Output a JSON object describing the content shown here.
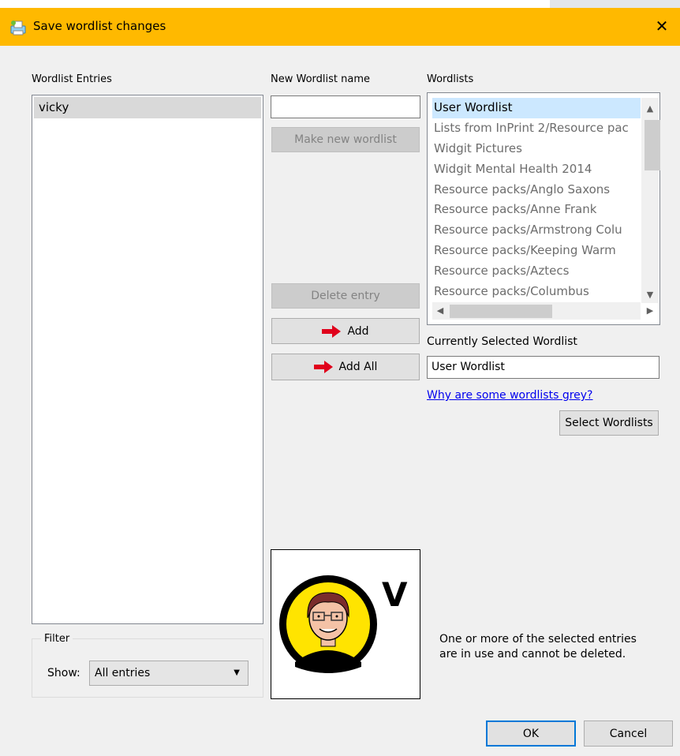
{
  "window": {
    "title": "Save wordlist changes",
    "close_glyph": "✕"
  },
  "entries": {
    "label": "Wordlist Entries",
    "items": [
      "vicky"
    ]
  },
  "new_wordlist": {
    "label": "New Wordlist name",
    "value": "",
    "make_button": "Make new wordlist"
  },
  "actions": {
    "delete_button": "Delete entry",
    "add_button": "Add",
    "add_all_button": "Add All"
  },
  "wordlists": {
    "label": "Wordlists",
    "items": [
      "User Wordlist",
      "Lists from InPrint 2/Resource pac",
      "Widgit Pictures",
      "Widgit Mental Health 2014",
      "Resource packs/Anglo Saxons",
      "Resource packs/Anne Frank",
      "Resource packs/Armstrong Colu",
      "Resource packs/Keeping Warm",
      "Resource packs/Aztecs",
      "Resource packs/Columbus"
    ]
  },
  "current": {
    "label": "Currently Selected Wordlist",
    "value": "User Wordlist"
  },
  "help_link": "Why are some wordlists grey?",
  "select_button": "Select Wordlists",
  "filter": {
    "legend": "Filter",
    "show_label": "Show:",
    "selected": "All entries"
  },
  "symbol": {
    "letter": "V"
  },
  "info": {
    "line1": "One or more of the selected entries",
    "line2": "are in use and cannot be deleted."
  },
  "footer": {
    "ok": "OK",
    "cancel": "Cancel"
  },
  "colors": {
    "titlebar": "#ffb900",
    "selection": "#cce8ff",
    "link": "#0000ee",
    "arrow": "#e0001b"
  }
}
